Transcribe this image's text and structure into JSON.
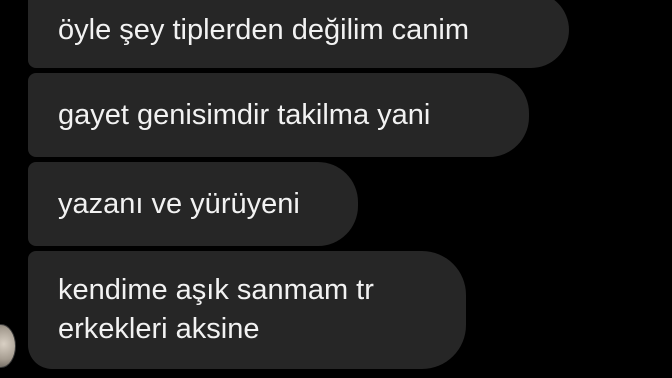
{
  "messages": [
    {
      "text": "öyle şey tiplerden değilim canim"
    },
    {
      "text": "gayet genisimdir takilma yani"
    },
    {
      "text": "yazanı ve yürüyeni"
    },
    {
      "text": "kendime aşık sanmam tr erkekleri aksine"
    }
  ],
  "icons": {
    "avatar": "sender-avatar"
  },
  "colors": {
    "background": "#000000",
    "bubble": "#262626",
    "text": "#f2f2f2"
  }
}
